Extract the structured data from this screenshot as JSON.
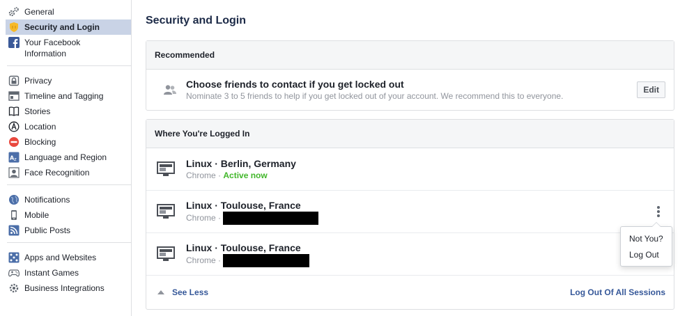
{
  "sidebar": {
    "groups": [
      {
        "items": [
          {
            "label": "General",
            "icon": "gears-icon",
            "selected": false
          },
          {
            "label": "Security and Login",
            "icon": "shield-icon",
            "selected": true
          },
          {
            "label": "Your Facebook Information",
            "icon": "facebook-icon",
            "selected": false
          }
        ]
      },
      {
        "items": [
          {
            "label": "Privacy",
            "icon": "lock-icon"
          },
          {
            "label": "Timeline and Tagging",
            "icon": "timeline-icon"
          },
          {
            "label": "Stories",
            "icon": "book-icon"
          },
          {
            "label": "Location",
            "icon": "location-icon"
          },
          {
            "label": "Blocking",
            "icon": "blocking-icon"
          },
          {
            "label": "Language and Region",
            "icon": "language-icon"
          },
          {
            "label": "Face Recognition",
            "icon": "face-recognition-icon"
          }
        ]
      },
      {
        "items": [
          {
            "label": "Notifications",
            "icon": "globe-icon"
          },
          {
            "label": "Mobile",
            "icon": "mobile-icon"
          },
          {
            "label": "Public Posts",
            "icon": "rss-icon"
          }
        ]
      },
      {
        "items": [
          {
            "label": "Apps and Websites",
            "icon": "apps-icon"
          },
          {
            "label": "Instant Games",
            "icon": "gamepad-icon"
          },
          {
            "label": "Business Integrations",
            "icon": "business-gear-icon"
          }
        ]
      }
    ]
  },
  "main": {
    "title": "Security and Login",
    "recommended": {
      "header": "Recommended",
      "title": "Choose friends to contact if you get locked out",
      "description": "Nominate 3 to 5 friends to help if you get locked out of your account. We recommend this to everyone.",
      "edit_label": "Edit"
    },
    "logged_in": {
      "header": "Where You're Logged In",
      "sessions": [
        {
          "title": "Linux · Berlin, Germany",
          "browser": "Chrome",
          "separator": " · ",
          "status": "Active now"
        },
        {
          "title": "Linux · Toulouse, France",
          "browser": "Chrome",
          "separator": " ·",
          "status": ""
        },
        {
          "title": "Linux · Toulouse, France",
          "browser": "Chrome",
          "separator": " ·",
          "status": ""
        }
      ],
      "see_less": "See Less",
      "log_out_all": "Log Out Of All Sessions"
    },
    "session_menu": {
      "items": [
        "Not You?",
        "Log Out"
      ]
    }
  },
  "colors": {
    "link": "#365899",
    "active": "#42b72a",
    "selected_bg": "#c9d3e6",
    "title": "#1c2a47"
  }
}
